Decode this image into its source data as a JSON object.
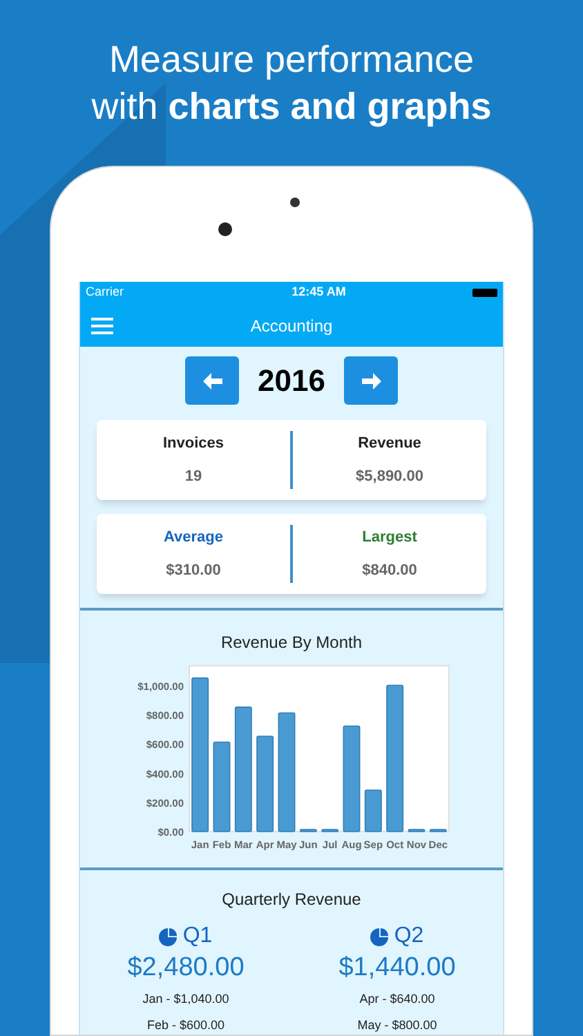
{
  "headline": {
    "line1": "Measure performance",
    "line2": "with **charts and graphs**"
  },
  "status_bar": {
    "carrier": "Carrier",
    "time": "12:45 AM"
  },
  "nav": {
    "title": "Accounting"
  },
  "year": {
    "value": "2016"
  },
  "stats": [
    {
      "label": "Invoices",
      "value": "19",
      "color": "#212121"
    },
    {
      "label": "Revenue",
      "value": "$5,890.00",
      "color": "#212121"
    },
    {
      "label": "Average",
      "value": "$310.00",
      "color": "#1565c0"
    },
    {
      "label": "Largest",
      "value": "$840.00",
      "color": "#2e7d32"
    }
  ],
  "revenue_chart": {
    "title": "Revenue By Month",
    "chart_data": {
      "type": "bar",
      "categories": [
        "Jan",
        "Feb",
        "Mar",
        "Apr",
        "May",
        "Jun",
        "Jul",
        "Aug",
        "Sep",
        "Oct",
        "Nov",
        "Dec"
      ],
      "series": [
        {
          "color": "#4a9bd4",
          "values": [
            1040,
            600,
            840,
            640,
            800,
            0,
            0,
            710,
            270,
            990,
            0,
            0
          ]
        }
      ],
      "ylim": [
        0,
        1100
      ],
      "yticks": [
        {
          "value": 0,
          "label": "$0.00"
        },
        {
          "value": 200,
          "label": "$200.00"
        },
        {
          "value": 400,
          "label": "$400.00"
        },
        {
          "value": 600,
          "label": "$600.00"
        },
        {
          "value": 800,
          "label": "$800.00"
        },
        {
          "value": 1000,
          "label": "$1,000.00"
        }
      ]
    }
  },
  "quarterly": {
    "title": "Quarterly Revenue",
    "quarters": [
      {
        "label": "Q1",
        "total": "$2,480.00",
        "months": [
          "Jan - $1,040.00",
          "Feb - $600.00"
        ]
      },
      {
        "label": "Q2",
        "total": "$1,440.00",
        "months": [
          "Apr - $640.00",
          "May - $800.00"
        ]
      }
    ]
  }
}
